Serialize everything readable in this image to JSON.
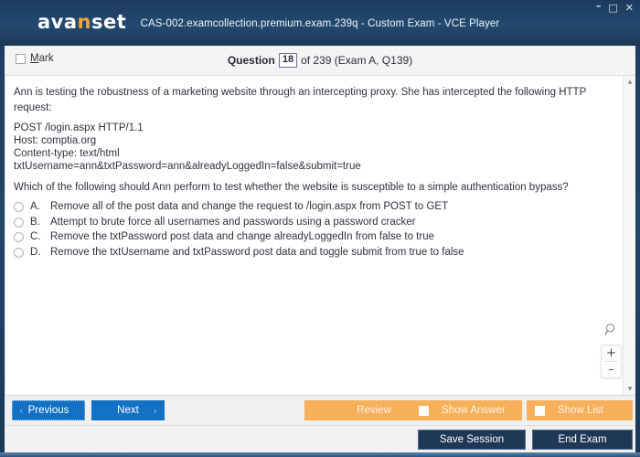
{
  "window": {
    "title": "CAS-002.examcollection.premium.exam.239q - Custom Exam - VCE Player",
    "logo_text_a": "ava",
    "logo_text_n": "n",
    "logo_text_b": "set",
    "minimize_icon": "–",
    "maximize_icon": "□",
    "close_icon": "✕",
    "titlebar_color": "#1d3b5c",
    "accent_orange": "#f2a33c"
  },
  "question_header": {
    "mark_label_before": "",
    "mark_label_accel": "M",
    "mark_label_after": "ark",
    "question_word": "Question",
    "question_number": "18",
    "rest": "of 239 (Exam A, Q139)"
  },
  "content": {
    "intro": "Ann is testing the robustness of a marketing website through an intercepting proxy. She has intercepted the following HTTP request:",
    "http_request": "POST /login.aspx HTTP/1.1\nHost: comptia.org\nContent-type: text/html\ntxtUsername=ann&txtPassword=ann&alreadyLoggedIn=false&submit=true",
    "prompt": "Which of the following should Ann perform to test whether the website is susceptible to a simple authentication bypass?",
    "options": [
      {
        "letter": "A.",
        "text": "Remove all of the post data and change the request to /login.aspx from POST to GET",
        "selected": false
      },
      {
        "letter": "B.",
        "text": "Attempt to brute force all usernames and passwords using a password cracker",
        "selected": false
      },
      {
        "letter": "C.",
        "text": "Remove the txtPassword post data and change alreadyLoggedIn from false to true",
        "selected": false
      },
      {
        "letter": "D.",
        "text": "Remove the txtUsername and txtPassword post data and toggle submit from true to false",
        "selected": false
      }
    ]
  },
  "zoom_widget": {
    "zoom_in_label": "+",
    "zoom_out_label": "–"
  },
  "scrollbar": {
    "up_arrow": "▲",
    "down_arrow": "▼"
  },
  "toolbar": {
    "previous_label": "Previous",
    "previous_chevron": "‹",
    "next_label": "Next",
    "next_chevron": "›",
    "review_label": "Review",
    "review_caret": "▲",
    "show_answer_label": "Show Answer",
    "show_list_label": "Show List",
    "orange_color": "#f8b05a",
    "blue_color": "#1271c4"
  },
  "statusbar": {
    "save_session_label": "Save Session",
    "end_exam_label": "End Exam",
    "dark_color": "#1f3855"
  }
}
